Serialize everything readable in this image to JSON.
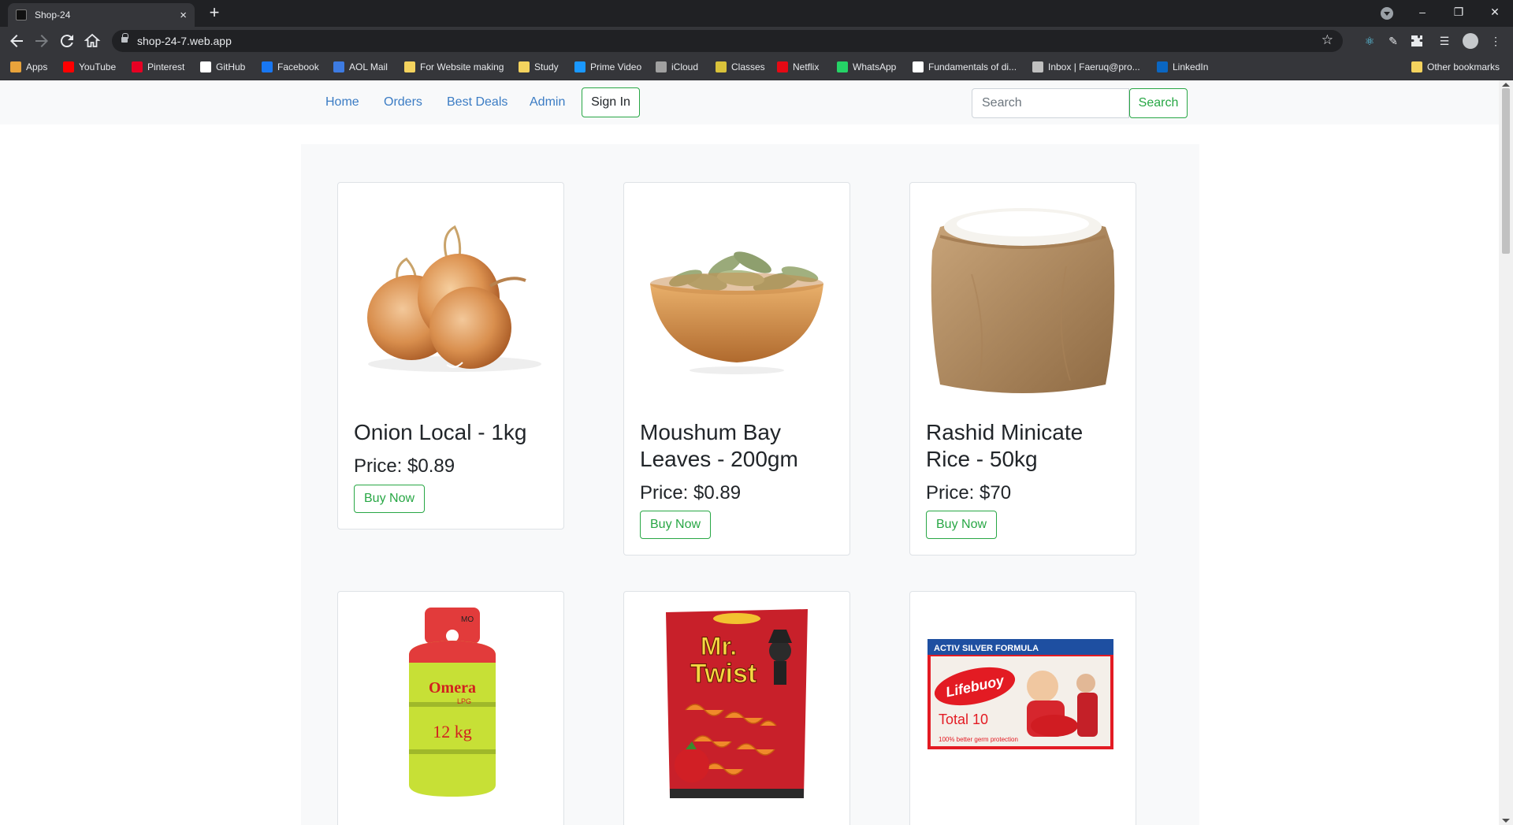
{
  "browser": {
    "tab_title": "Shop-24",
    "tab_close": "×",
    "new_tab": "+",
    "url": "shop-24-7.web.app",
    "window_controls": {
      "minimize": "–",
      "restore": "❐",
      "close": "✕"
    },
    "bookmarks": [
      {
        "label": "Apps",
        "icon_color": "#e8a33b",
        "icon": "apps-grid-icon"
      },
      {
        "label": "YouTube",
        "icon_color": "#ff0000",
        "icon": "youtube-icon"
      },
      {
        "label": "Pinterest",
        "icon_color": "#e60023",
        "icon": "pinterest-icon"
      },
      {
        "label": "GitHub",
        "icon_color": "#ffffff",
        "icon": "github-icon"
      },
      {
        "label": "Facebook",
        "icon_color": "#1877f2",
        "icon": "facebook-icon"
      },
      {
        "label": "AOL Mail",
        "icon_color": "#3d7be2",
        "icon": "aol-icon"
      },
      {
        "label": "For Website making",
        "icon_color": "#f4d35e",
        "icon": "folder-icon"
      },
      {
        "label": "Study",
        "icon_color": "#f4d35e",
        "icon": "folder-icon"
      },
      {
        "label": "Prime Video",
        "icon_color": "#1a98ff",
        "icon": "prime-video-icon"
      },
      {
        "label": "iCloud",
        "icon_color": "#a0a0a0",
        "icon": "apple-icon"
      },
      {
        "label": "Classes",
        "icon_color": "#d9c23a",
        "icon": "classes-icon"
      },
      {
        "label": "Netflix",
        "icon_color": "#e50914",
        "icon": "netflix-icon"
      },
      {
        "label": "WhatsApp",
        "icon_color": "#25d366",
        "icon": "whatsapp-icon"
      },
      {
        "label": "Fundamentals of di...",
        "icon_color": "#ffffff",
        "icon": "google-icon"
      },
      {
        "label": "Inbox | Faeruq@pro...",
        "icon_color": "#c0c0c0",
        "icon": "lock-icon"
      },
      {
        "label": "LinkedIn",
        "icon_color": "#0a66c2",
        "icon": "linkedin-icon"
      }
    ],
    "other_bookmarks": "Other bookmarks"
  },
  "navbar": {
    "links": [
      "Home",
      "Orders",
      "Best Deals",
      "Admin"
    ],
    "signin_label": "Sign In",
    "search_placeholder": "Search",
    "search_button": "Search"
  },
  "products": [
    {
      "name": "Onion Local - 1kg",
      "price": "Price: $0.89",
      "buy": "Buy Now",
      "image": "onion"
    },
    {
      "name": "Moushum Bay Leaves - 200gm",
      "price": "Price: $0.89",
      "buy": "Buy Now",
      "image": "bay-leaves"
    },
    {
      "name": "Rashid Minicate Rice - 50kg",
      "price": "Price: $70",
      "buy": "Buy Now",
      "image": "rice-sack"
    },
    {
      "image": "gas-cylinder",
      "brand_text": "Omera",
      "sub_text": "LPG",
      "weight_text": "12 kg"
    },
    {
      "image": "mr-twist",
      "brand_text": "Mr.",
      "sub_text": "Twist"
    },
    {
      "image": "lifebuoy",
      "banner_text": "ACTIV SILVER FORMULA",
      "brand_text": "Lifebuoy",
      "sub_text": "Total 10",
      "footer_text": "100% better germ protection"
    }
  ]
}
